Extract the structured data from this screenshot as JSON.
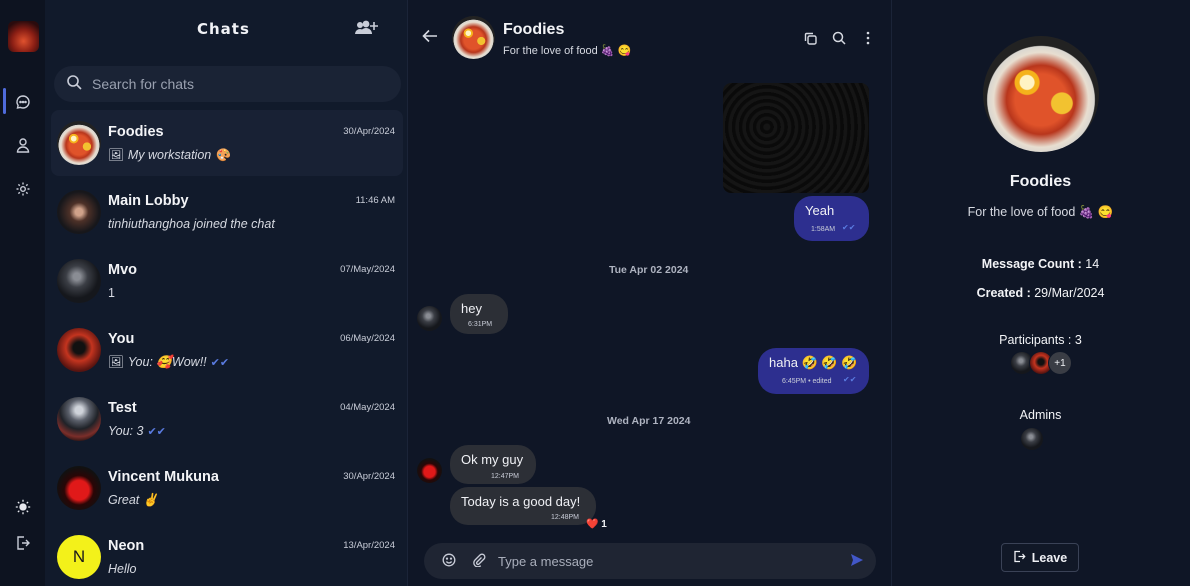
{
  "rail": {
    "icons": [
      "chat-icon",
      "user-icon",
      "settings-icon",
      "theme-sun-icon",
      "logout-icon"
    ]
  },
  "chatlist": {
    "title": "Chats",
    "search_placeholder": "Search for chats",
    "chats": [
      {
        "name": "Foodies",
        "date": "30/Apr/2024",
        "preview": "My workstation 🎨",
        "has_image_icon": true
      },
      {
        "name": "Main Lobby",
        "date": "11:46 AM",
        "preview": "tinhiuthanghoa joined the chat"
      },
      {
        "name": "Mvo",
        "date": "07/May/2024",
        "preview": "1"
      },
      {
        "name": "You",
        "date": "06/May/2024",
        "preview": "You: 🥰Wow!!",
        "has_image_icon": true
      },
      {
        "name": "Test",
        "date": "04/May/2024",
        "preview": "You: 3"
      },
      {
        "name": "Vincent Mukuna",
        "date": "30/Apr/2024",
        "preview": "Great ✌️"
      },
      {
        "name": "Neon",
        "date": "13/Apr/2024",
        "preview": "Hello",
        "initial": "N"
      }
    ]
  },
  "conversation": {
    "name": "Foodies",
    "subtitle": "For the love of food 🍇 😋",
    "messages": [
      {
        "text": "Yeah",
        "time": "1:58AM"
      },
      {
        "day": "Tue Apr 02 2024"
      },
      {
        "text": "hey",
        "time": "6:31PM"
      },
      {
        "text": "haha 🤣 🤣 🤣",
        "time": "6:45PM • edited"
      },
      {
        "day": "Wed Apr 17 2024"
      },
      {
        "text": "Ok my guy",
        "time": "12:47PM"
      },
      {
        "text": "Today is a good day!",
        "time": "12:48PM",
        "reaction": "❤️ 1"
      }
    ],
    "composer_placeholder": "Type a message"
  },
  "info": {
    "name": "Foodies",
    "description": "For the love of food 🍇 😋",
    "message_count_label": "Message Count :",
    "message_count": "14",
    "created_label": "Created :",
    "created": "29/Mar/2024",
    "participants_label": "Participants :",
    "participants": "3",
    "participants_more": "+1",
    "admins_label": "Admins",
    "leave_label": "Leave"
  }
}
